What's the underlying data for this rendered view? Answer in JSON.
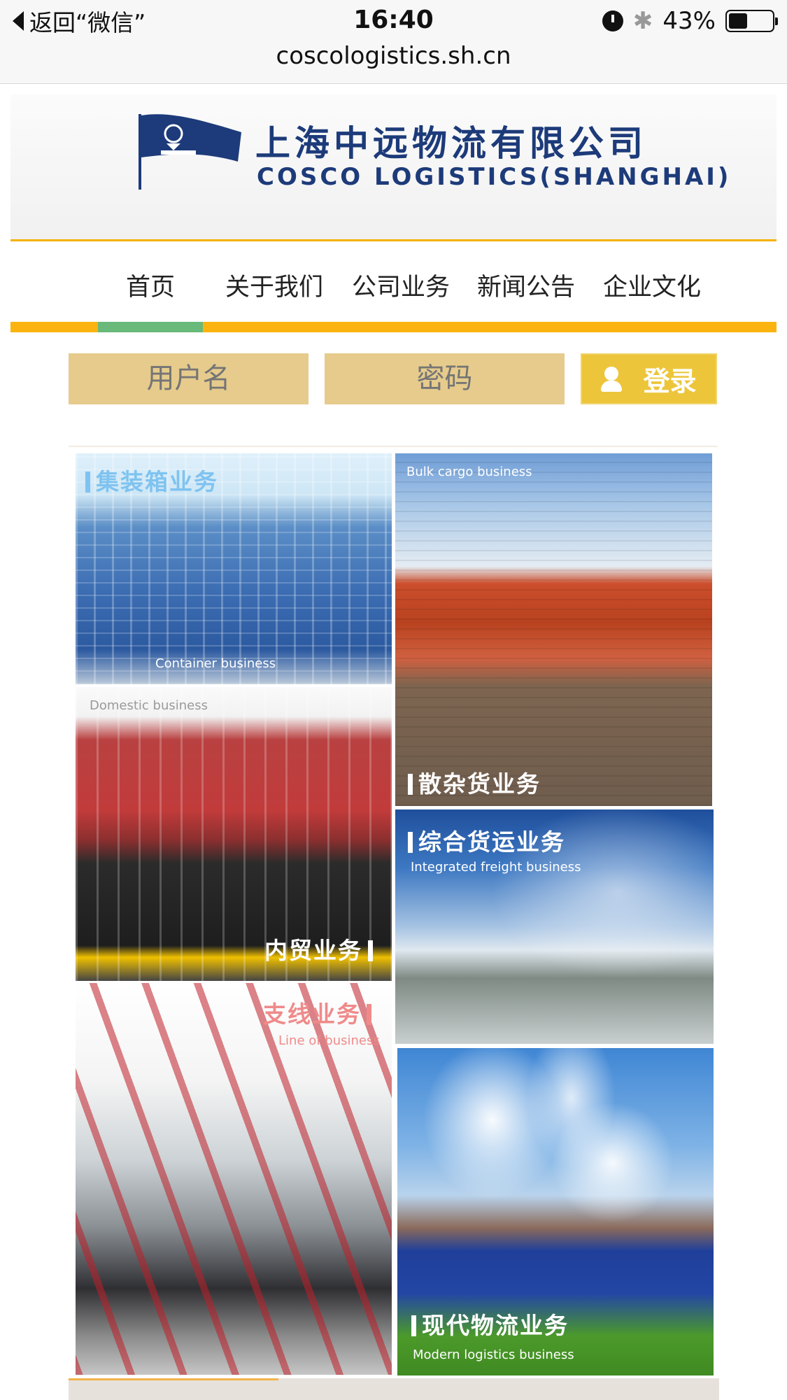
{
  "status_bar": {
    "back_label": "返回“微信”",
    "time": "16:40",
    "battery_percent": "43%",
    "battery_level": 0.43,
    "url": "coscologistics.sh.cn"
  },
  "header": {
    "brand_cn": "上海中远物流有限公司",
    "brand_en": "COSCO LOGISTICS(SHANGHAI)"
  },
  "nav": {
    "items": [
      {
        "label": "首页"
      },
      {
        "label": "关于我们"
      },
      {
        "label": "公司业务"
      },
      {
        "label": "新闻公告"
      },
      {
        "label": "企业文化"
      }
    ],
    "active_index": 0,
    "colors": {
      "bar": "#fbb40f",
      "active": "#69b97a"
    }
  },
  "login": {
    "username_placeholder": "用户名",
    "password_placeholder": "密码",
    "button_label": "登录"
  },
  "tiles": {
    "container": {
      "cn": "集装箱业务",
      "en": "Container business"
    },
    "bulk": {
      "cn": "散杂货业务",
      "en": "Bulk cargo business"
    },
    "domestic": {
      "cn": "内贸业务",
      "en": "Domestic business"
    },
    "integrated": {
      "cn": "综合货运业务",
      "en": "Integrated freight business"
    },
    "line": {
      "cn": "支线业务",
      "en": "Line of business"
    },
    "modern": {
      "cn": "现代物流业务",
      "en": "Modern logistics business"
    }
  }
}
